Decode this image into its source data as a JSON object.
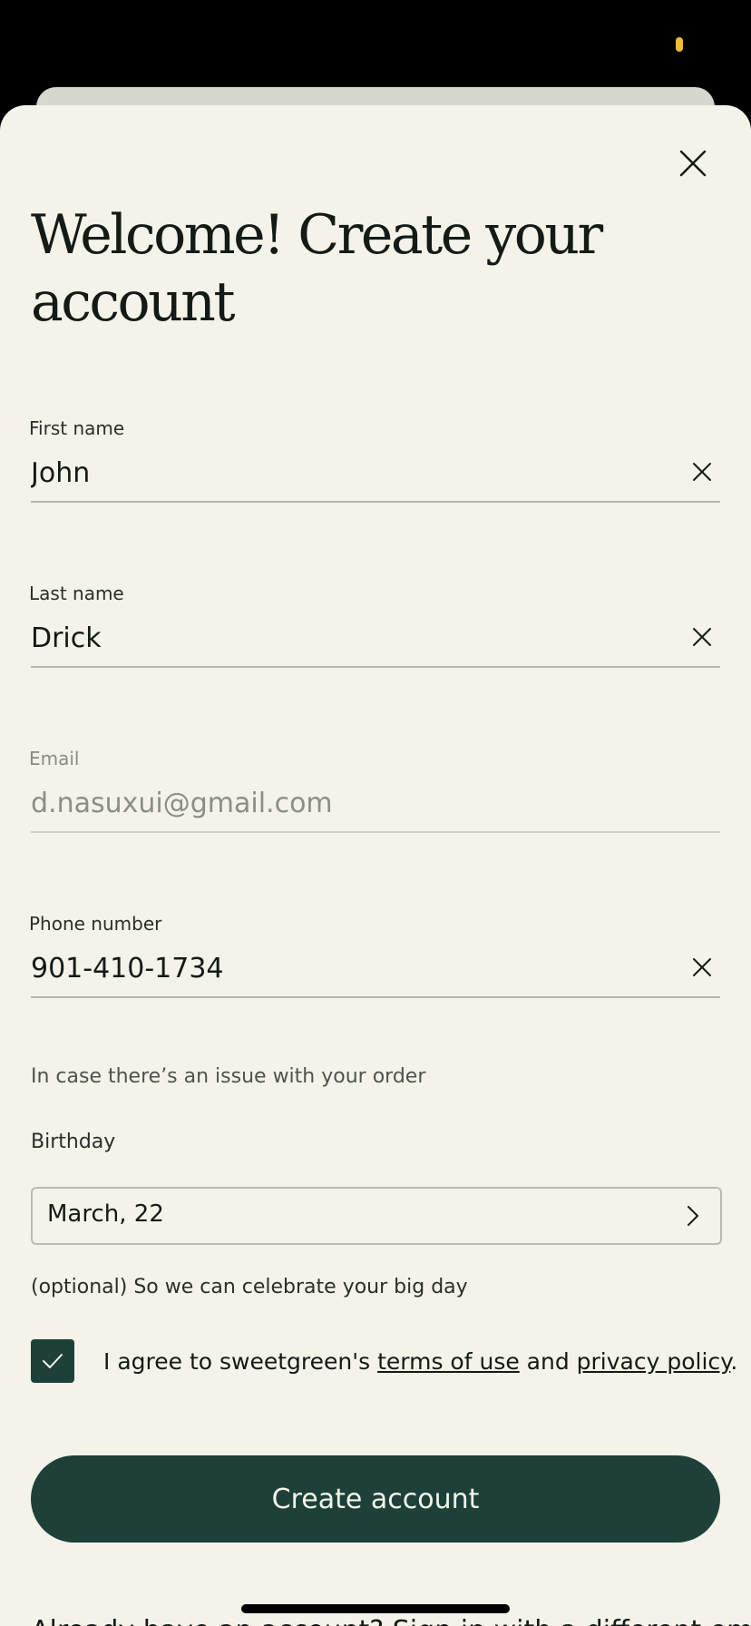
{
  "colors": {
    "background": "#f3f3e9",
    "primary": "#1d4139",
    "text": "#141a16",
    "status_indicator": "#f2b93b"
  },
  "header": {
    "title": "Welcome! Create your account",
    "close_icon": "close-icon"
  },
  "form": {
    "first_name": {
      "label": "First name",
      "value": "John",
      "clear_icon": "close-icon"
    },
    "last_name": {
      "label": "Last name",
      "value": "Drick",
      "clear_icon": "close-icon"
    },
    "email": {
      "label": "Email",
      "placeholder": "d.nasuxui@gmail.com"
    },
    "phone": {
      "label": "Phone number",
      "value": "901-410-1734",
      "helper": "In case there’s an issue with your order",
      "clear_icon": "close-icon"
    },
    "birthday": {
      "label": "Birthday",
      "value": "March, 22",
      "helper": "(optional) So we can celebrate your big day",
      "chevron_icon": "chevron-right-icon"
    }
  },
  "agreement": {
    "checked": true,
    "prefix": "I agree to sweetgreen's ",
    "terms_link": "terms of use",
    "middle": " and ",
    "privacy_link": "privacy policy",
    "suffix": ".",
    "check_icon": "check-icon"
  },
  "actions": {
    "create_label": "Create account"
  },
  "footer": {
    "signin_text": "Already have an account? Sign in with a different email"
  }
}
